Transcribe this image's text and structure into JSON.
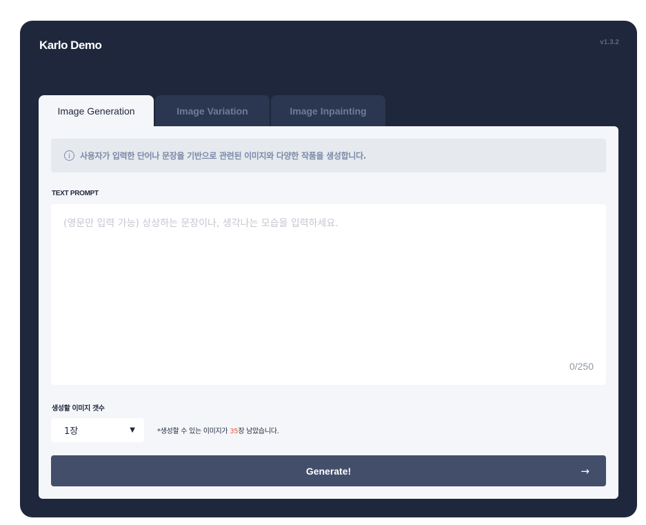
{
  "app": {
    "title": "Karlo Demo",
    "version": "v1.3.2"
  },
  "tabs": [
    {
      "label": "Image Generation",
      "active": true
    },
    {
      "label": "Image Variation",
      "active": false
    },
    {
      "label": "Image Inpainting",
      "active": false
    }
  ],
  "info": {
    "icon": "info-icon",
    "text": "사용자가 입력한 단어나 문장을 기반으로 관련된 이미지와 다양한 작품을 생성합니다."
  },
  "prompt": {
    "label": "TEXT PROMPT",
    "value": "",
    "placeholder": "(영문만 입력 가능) 상상하는 문장이나, 생각나는 모습을 입력하세요.",
    "counter": "0/250"
  },
  "count": {
    "label": "생성할 이미지 갯수",
    "selected": "1장",
    "remaining_prefix": "*생성할 수 있는 이미지가 ",
    "remaining_number": "35",
    "remaining_suffix": "장 남았습니다."
  },
  "generate": {
    "label": "Generate!",
    "icon": "arrow-right-icon"
  },
  "colors": {
    "background": "#1e273b",
    "panel": "#f4f6f9",
    "button": "#434e6b",
    "accent_number": "#e85a3c"
  }
}
